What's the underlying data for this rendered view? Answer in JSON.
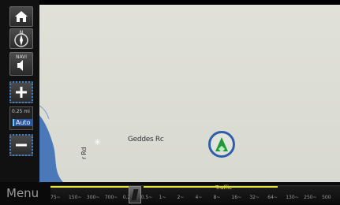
{
  "map": {
    "road_labels": [
      "Geddes Rc",
      "r Rd"
    ],
    "colors": {
      "land": "#dcdcd4",
      "water": "#4a78b8",
      "position_ring": "#2f5fa8",
      "position_arrow": "#1f9a3a"
    }
  },
  "sidebar": {
    "home_icon": "home-icon",
    "compass_label": "N",
    "navi_label": "NAVI",
    "scale_text": "0.25 mi",
    "auto_label": "Auto",
    "zoom_in_label": "+",
    "zoom_out_label": "−"
  },
  "bottom_bar": {
    "menu_label": "Menu",
    "traffic_label": "Traffic",
    "scale_ticks": [
      "75~",
      "150~",
      "300~",
      "700~",
      "0.25~",
      "0.5~",
      "1~",
      "2~",
      "4~",
      "8~",
      "16~",
      "32~",
      "64~",
      "130~",
      "250~",
      "500"
    ],
    "accent_color": "#e6e23c"
  }
}
